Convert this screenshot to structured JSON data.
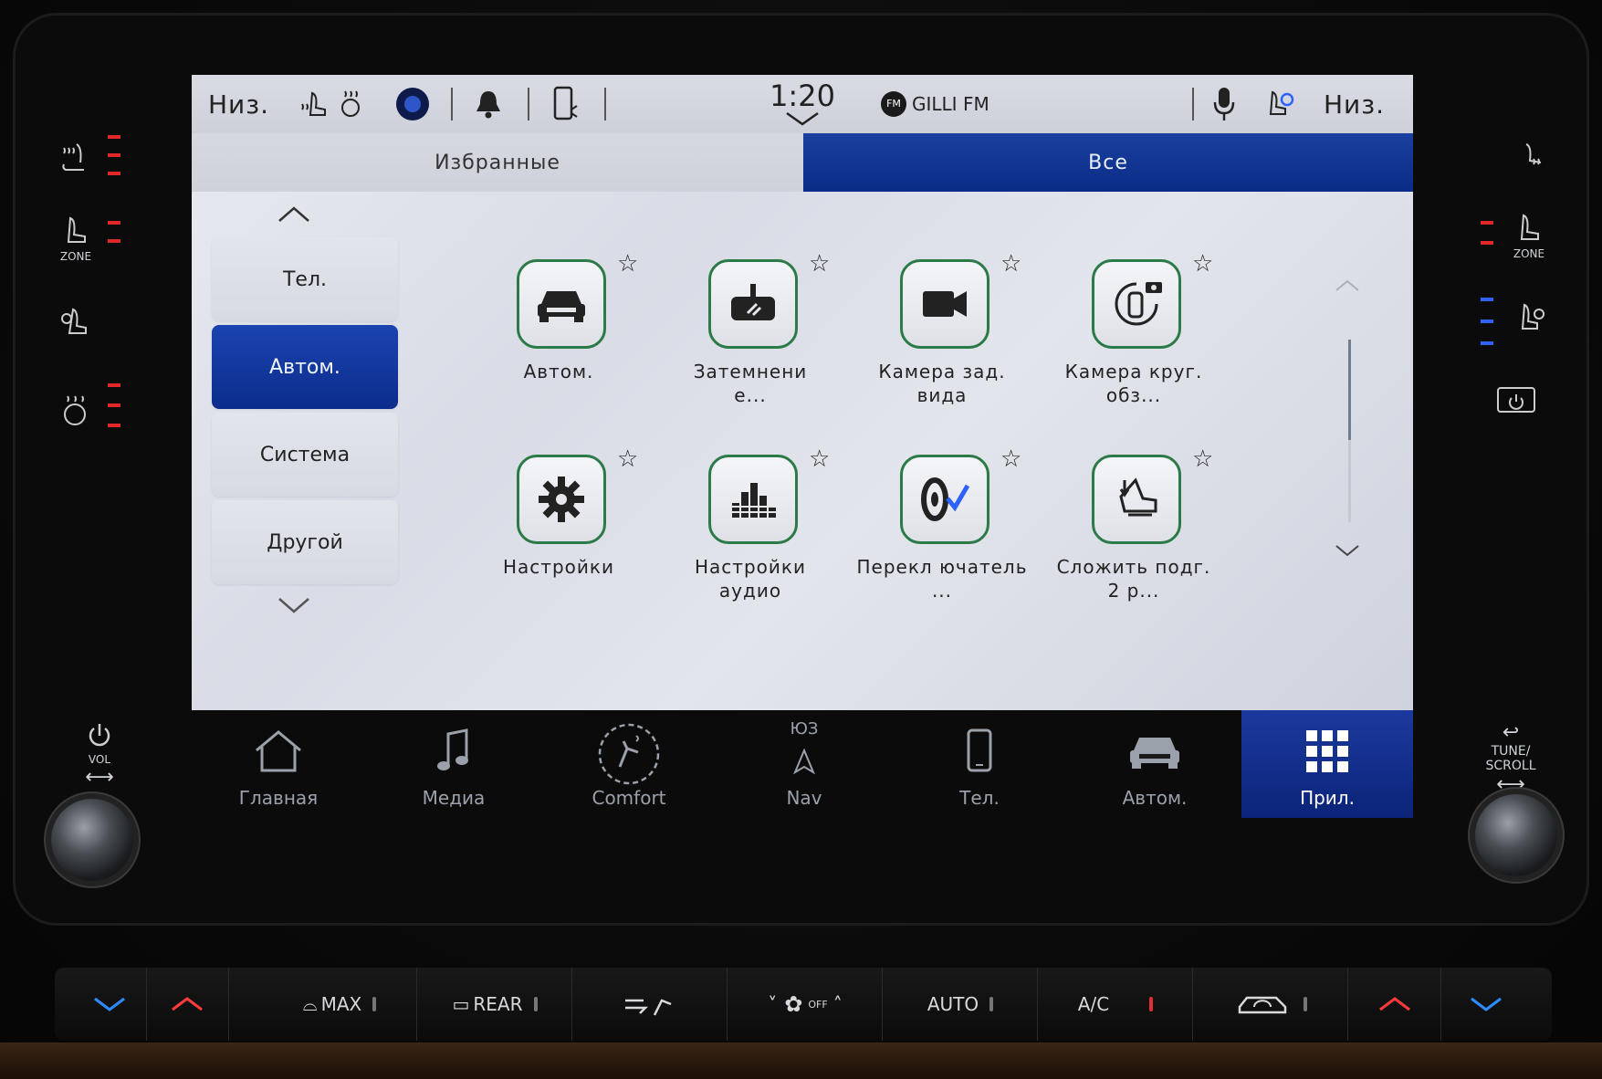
{
  "status_bar": {
    "left_temp": "Низ.",
    "time": "1:20",
    "radio_badge": "FM",
    "radio_station": "GILLI FM",
    "right_temp": "Низ."
  },
  "tabs": [
    {
      "label": "Избранные",
      "active": false
    },
    {
      "label": "Все",
      "active": true
    }
  ],
  "categories": [
    {
      "label": "Тел.",
      "active": false
    },
    {
      "label": "Автом.",
      "active": true
    },
    {
      "label": "Система",
      "active": false
    },
    {
      "label": "Другой",
      "active": false
    }
  ],
  "apps": [
    {
      "label": "Автом.",
      "icon": "car-icon"
    },
    {
      "label": "Затемнени е...",
      "icon": "rearview-mirror-icon"
    },
    {
      "label": "Камера зад. вида",
      "icon": "camera-icon"
    },
    {
      "label": "Камера круг. обз...",
      "icon": "surround-camera-icon"
    },
    {
      "label": "Настройки",
      "icon": "gear-icon"
    },
    {
      "label": "Настройки аудио",
      "icon": "equalizer-icon"
    },
    {
      "label": "Перекл ючатель ...",
      "icon": "tire-icon"
    },
    {
      "label": "Сложить подг. 2 р...",
      "icon": "seat-fold-icon"
    }
  ],
  "dock": [
    {
      "label": "Главная",
      "icon": "home-icon",
      "active": false
    },
    {
      "label": "Медиа",
      "icon": "music-note-icon",
      "active": false
    },
    {
      "label": "Comfort",
      "icon": "comfort-icon",
      "active": false
    },
    {
      "label": "Nav",
      "icon": "compass-icon",
      "active": false,
      "heading": "ЮЗ"
    },
    {
      "label": "Тел.",
      "icon": "phone-icon",
      "active": false
    },
    {
      "label": "Автом.",
      "icon": "car-icon",
      "active": false
    },
    {
      "label": "Прил.",
      "icon": "apps-grid-icon",
      "active": true
    }
  ],
  "side_left": {
    "zone_label": "ZONE",
    "vol_label": "VOL"
  },
  "side_right": {
    "zone_label": "ZONE",
    "tune_label": "TUNE/ SCROLL"
  },
  "physical_buttons": {
    "max": "MAX",
    "rear": "REAR",
    "fan_off": "OFF",
    "auto": "AUTO",
    "ac": "A/C"
  },
  "colors": {
    "accent_blue": "#0b2c8c",
    "icon_border_green": "#2b7a47",
    "indicator_red": "#e02828",
    "indicator_blue": "#2d62ff"
  }
}
